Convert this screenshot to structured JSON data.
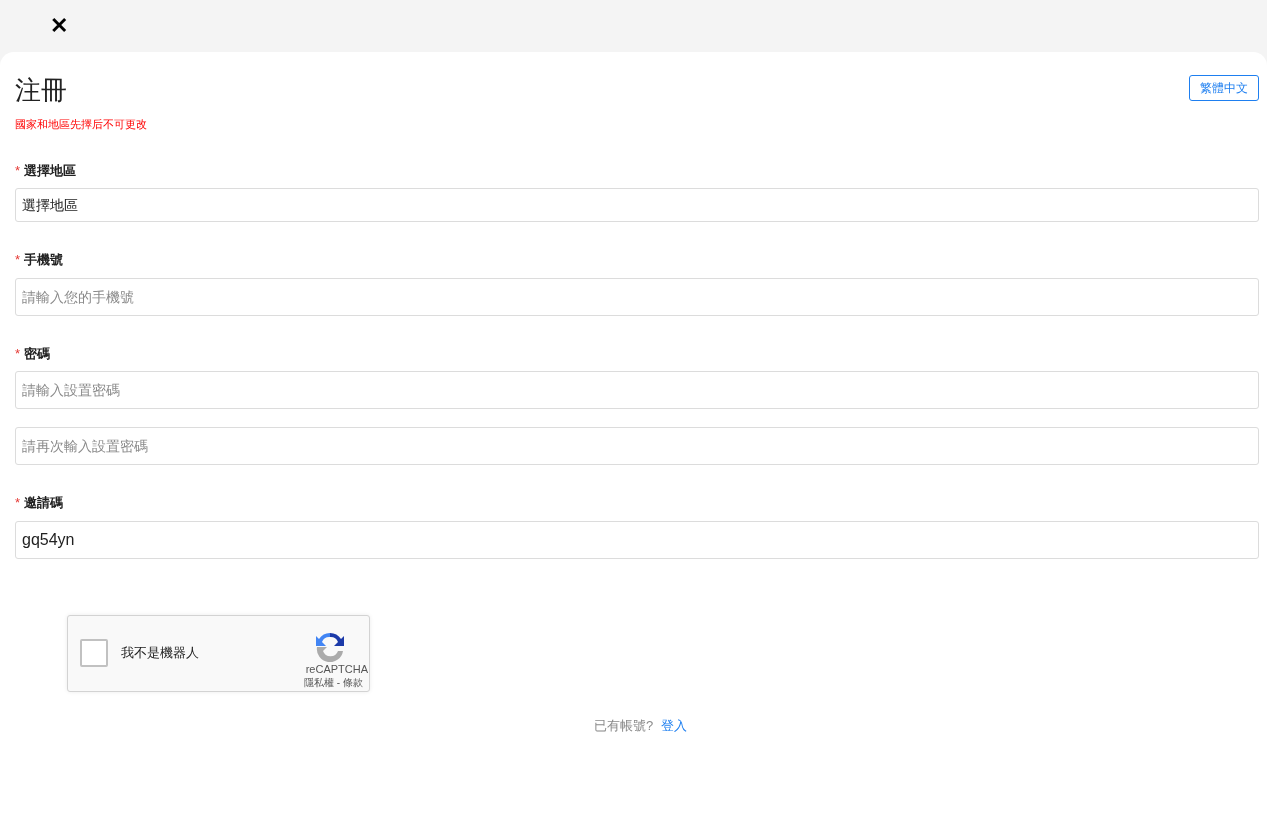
{
  "close_icon": "✕",
  "title": "注冊",
  "language_button": "繁體中文",
  "notice": "國家和地區先擇后不可更改",
  "groups": [
    {
      "label": "選擇地區",
      "required_mark": "*",
      "fields": [
        {
          "kind": "select",
          "value": "選擇地區"
        }
      ]
    },
    {
      "label": "手機號",
      "required_mark": "*",
      "fields": [
        {
          "kind": "input",
          "placeholder": "請輸入您的手機號"
        }
      ]
    },
    {
      "label": "密碼",
      "required_mark": "*",
      "fields": [
        {
          "kind": "input",
          "placeholder": "請輸入設置密碼"
        },
        {
          "kind": "input",
          "placeholder": "請再次輸入設置密碼"
        }
      ]
    },
    {
      "label": "邀請碼",
      "required_mark": "*",
      "fields": [
        {
          "kind": "input",
          "value": "gq54yn"
        }
      ]
    }
  ],
  "captcha": {
    "checked": false,
    "label": "我不是機器人",
    "brand": "reCAPTCHA",
    "privacy_link": "隱私權",
    "separator": "-",
    "terms_link": "條款"
  },
  "footer": {
    "text": "已有帳號?",
    "link": "登入"
  }
}
